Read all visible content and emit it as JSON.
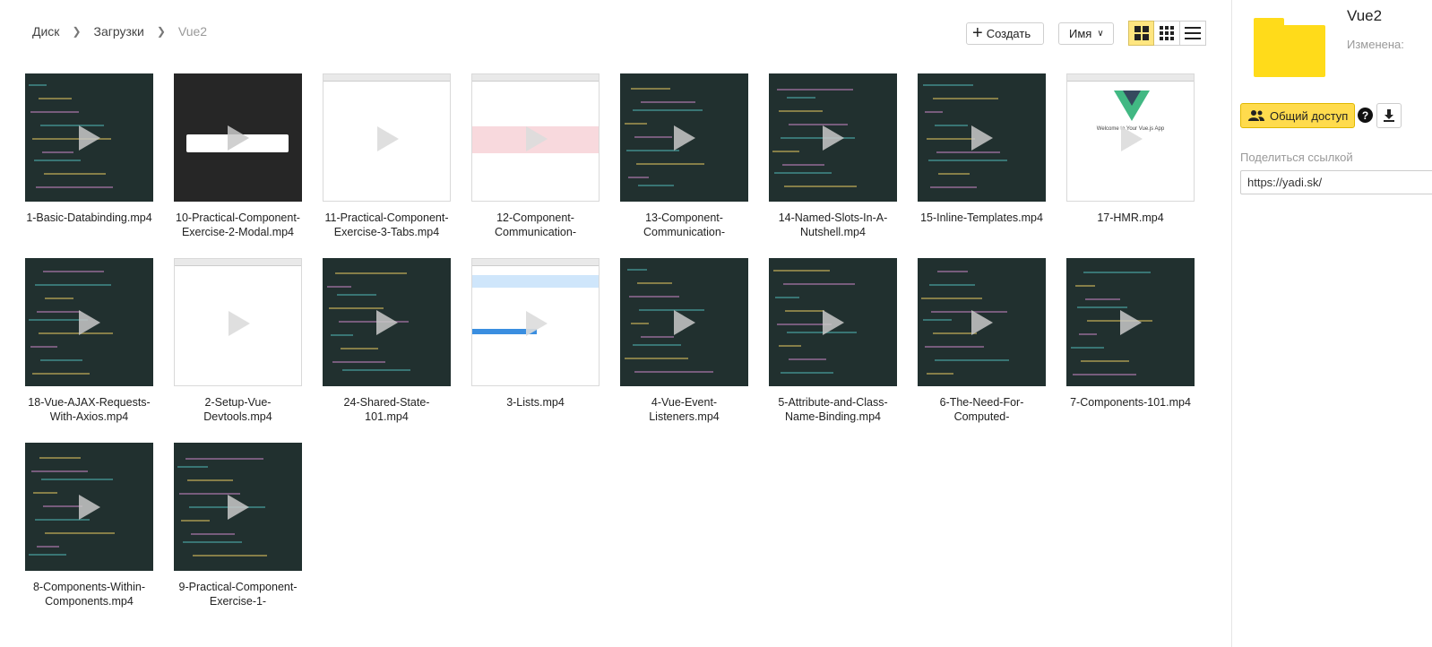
{
  "breadcrumb": [
    "Диск",
    "Загрузки",
    "Vue2"
  ],
  "toolbar": {
    "create_label": "Создать",
    "sort_label": "Имя"
  },
  "colors": {
    "accent": "#ffdb4d",
    "folder": "#ffdb1a",
    "code_bg": "#21302f"
  },
  "files": [
    {
      "name": "1-Basic-Databinding.mp4",
      "thumb": "dark"
    },
    {
      "name": "10-Practical-Component-Exercise-2-Modal.mp4",
      "thumb": "black"
    },
    {
      "name": "11-Practical-Component-Exercise-3-Tabs.mp4",
      "thumb": "light"
    },
    {
      "name": "12-Component-Communication-",
      "thumb": "light-red"
    },
    {
      "name": "13-Component-Communication-",
      "thumb": "dark"
    },
    {
      "name": "14-Named-Slots-In-A-Nutshell.mp4",
      "thumb": "dark"
    },
    {
      "name": "15-Inline-Templates.mp4",
      "thumb": "dark"
    },
    {
      "name": "17-HMR.mp4",
      "thumb": "vue"
    },
    {
      "name": "18-Vue-AJAX-Requests-With-Axios.mp4",
      "thumb": "dark"
    },
    {
      "name": "2-Setup-Vue-Devtools.mp4",
      "thumb": "light"
    },
    {
      "name": "24-Shared-State-101.mp4",
      "thumb": "dark"
    },
    {
      "name": "3-Lists.mp4",
      "thumb": "light-blue"
    },
    {
      "name": "4-Vue-Event-Listeners.mp4",
      "thumb": "dark"
    },
    {
      "name": "5-Attribute-and-Class-Name-Binding.mp4",
      "thumb": "dark"
    },
    {
      "name": "6-The-Need-For-Computed-",
      "thumb": "dark"
    },
    {
      "name": "7-Components-101.mp4",
      "thumb": "dark"
    },
    {
      "name": "8-Components-Within-Components.mp4",
      "thumb": "dark"
    },
    {
      "name": "9-Practical-Component-Exercise-1-",
      "thumb": "dark"
    }
  ],
  "vue_app_text": "Welcome to Your Vue.js App",
  "panel": {
    "title": "Vue2",
    "modified_label": "Изменена:",
    "share_button": "Общий доступ",
    "help_glyph": "?",
    "share_link_label": "Поделиться ссылкой",
    "share_link_value": "https://yadi.sk/"
  }
}
